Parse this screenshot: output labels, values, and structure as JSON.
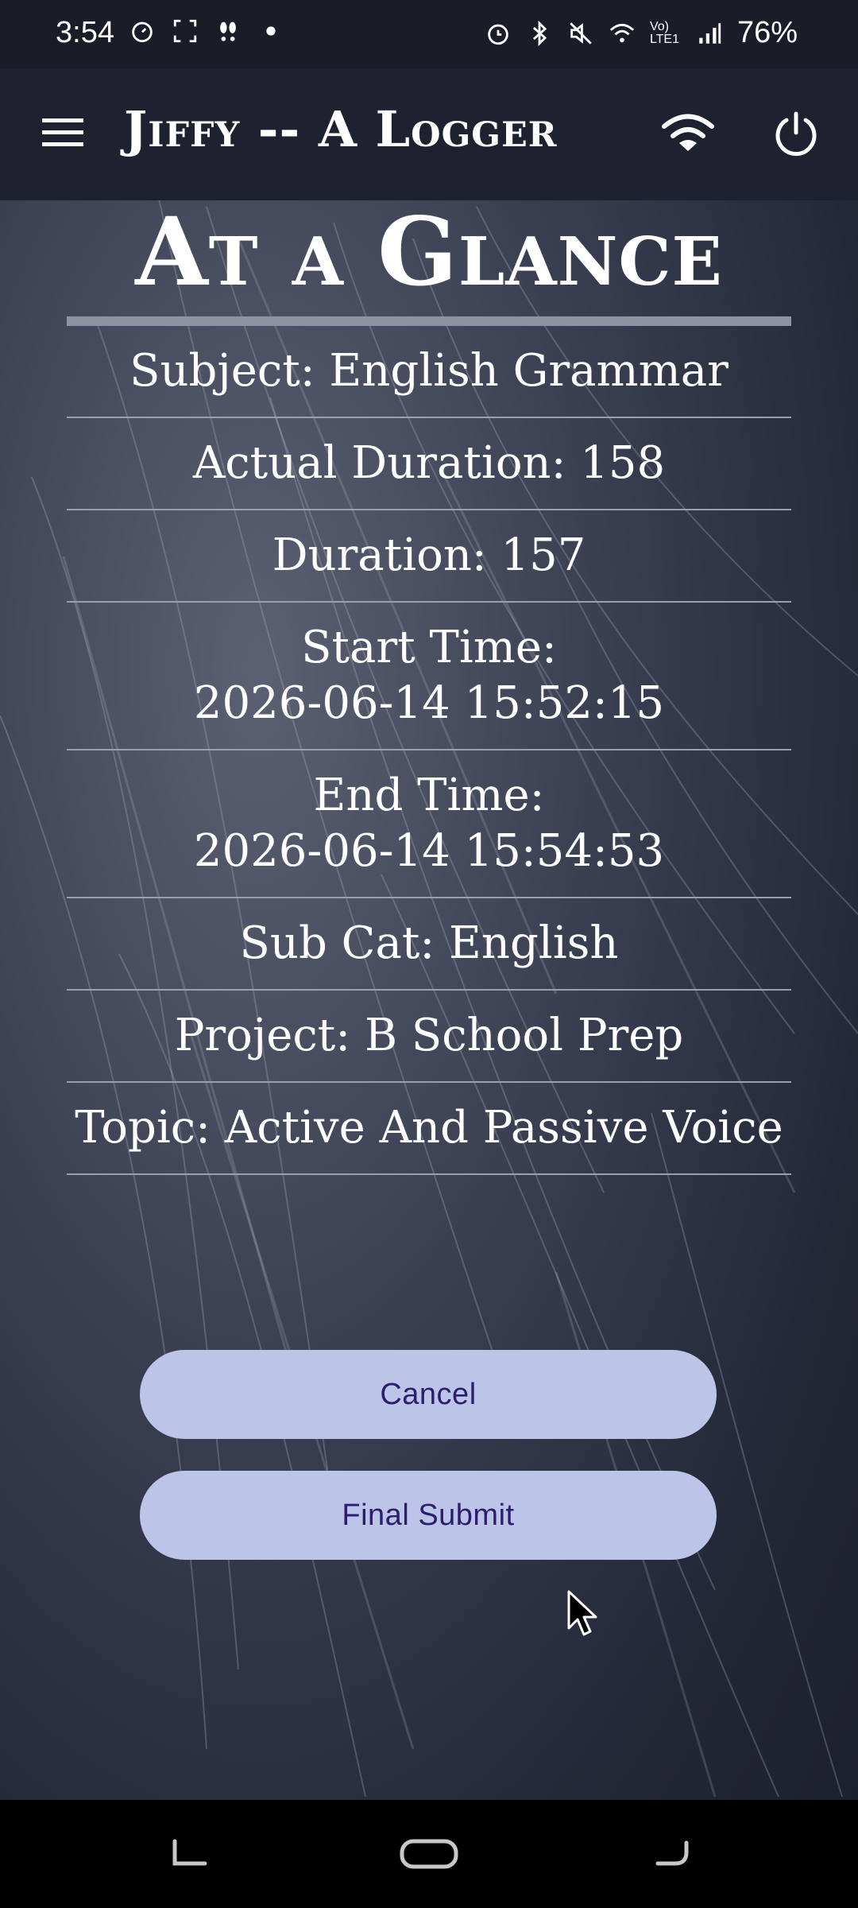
{
  "status_bar": {
    "time": "3:54",
    "battery": "76%",
    "left_icons": [
      "timer-icon",
      "screenshot-icon",
      "footprints-icon",
      "dot-icon"
    ],
    "right_icons": [
      "alarm-icon",
      "bluetooth-icon",
      "mute-icon",
      "wifi-status-icon",
      "volte-icon",
      "signal-icon"
    ],
    "volte_label": "Vo) LTE1"
  },
  "app_bar": {
    "title": "Jiffy -- A Logger"
  },
  "page": {
    "title": "At a Glance"
  },
  "details": [
    {
      "lines": [
        "Subject: English Grammar"
      ]
    },
    {
      "lines": [
        "Actual Duration: 158"
      ]
    },
    {
      "lines": [
        "Duration: 157"
      ]
    },
    {
      "lines": [
        "Start Time:",
        "2026-06-14 15:52:15"
      ]
    },
    {
      "lines": [
        "End Time:",
        "2026-06-14 15:54:53"
      ]
    },
    {
      "lines": [
        "Sub Cat: English"
      ]
    },
    {
      "lines": [
        "Project: B School Prep"
      ]
    },
    {
      "lines": [
        "Topic: Active And Passive Voice"
      ]
    }
  ],
  "buttons": {
    "cancel_label": "Cancel",
    "submit_label": "Final Submit"
  },
  "colors": {
    "button_bg": "#bcc5e8",
    "button_text": "#2c1d6e",
    "app_bar_bg": "#1e2230"
  }
}
